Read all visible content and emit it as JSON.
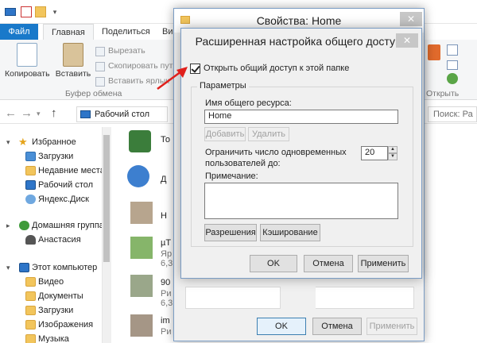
{
  "explorer": {
    "tabs": {
      "file": "Файл",
      "home": "Главная",
      "share": "Поделиться",
      "view_partial": "Ви"
    },
    "ribbon": {
      "copy": "Копировать",
      "paste": "Вставить",
      "cut": "Вырезать",
      "copy_path": "Скопировать путь",
      "paste_shortcut": "Вставить ярлык",
      "clipboard_group": "Буфер обмена",
      "open_group_partial": "Открыть"
    },
    "address": "Рабочий стол",
    "search_placeholder": "Поиск: Ра",
    "nav": {
      "favorites": "Избранное",
      "downloads": "Загрузки",
      "recent": "Недавние места",
      "desktop": "Рабочий стол",
      "yandex_disk": "Яндекс.Диск",
      "homegroup": "Домашняя группа",
      "user": "Анастасия",
      "this_pc": "Этот компьютер",
      "videos": "Видео",
      "documents": "Документы",
      "pc_downloads": "Загрузки",
      "pictures": "Изображения",
      "music": "Музыка"
    },
    "files": [
      {
        "name": "То"
      },
      {
        "name": "Д"
      },
      {
        "name": "Н"
      },
      {
        "name": "µT",
        "sub": "Яр"
      },
      {
        "name": "90",
        "sub": "Ри"
      },
      {
        "name": "im",
        "sub": "Ри"
      }
    ],
    "file_subs": {
      "f3": "6,3",
      "f5": "6,3"
    }
  },
  "properties_dialog": {
    "title": "Свойства: Home",
    "close": "✕",
    "ok": "OK",
    "cancel": "Отмена",
    "apply": "Применить"
  },
  "advanced_sharing": {
    "title": "Расширенная настройка общего доступа",
    "close": "✕",
    "share_checkbox": {
      "label": "Открыть общий доступ к этой папке",
      "checked": true
    },
    "params_legend": "Параметры",
    "share_name_label": "Имя общего ресурса:",
    "share_name_value": "Home",
    "add": "Добавить",
    "remove": "Удалить",
    "limit_label_1": "Ограничить число одновременных",
    "limit_label_2": "пользователей до:",
    "limit_value": "20",
    "note_label": "Примечание:",
    "note_value": "",
    "permissions": "Разрешения",
    "caching": "Кэширование",
    "ok": "OK",
    "cancel": "Отмена",
    "apply": "Применить"
  },
  "colors": {
    "accent": "#1979ca",
    "arrow": "#e0201c",
    "dialog_bg": "#f0f0f0"
  }
}
